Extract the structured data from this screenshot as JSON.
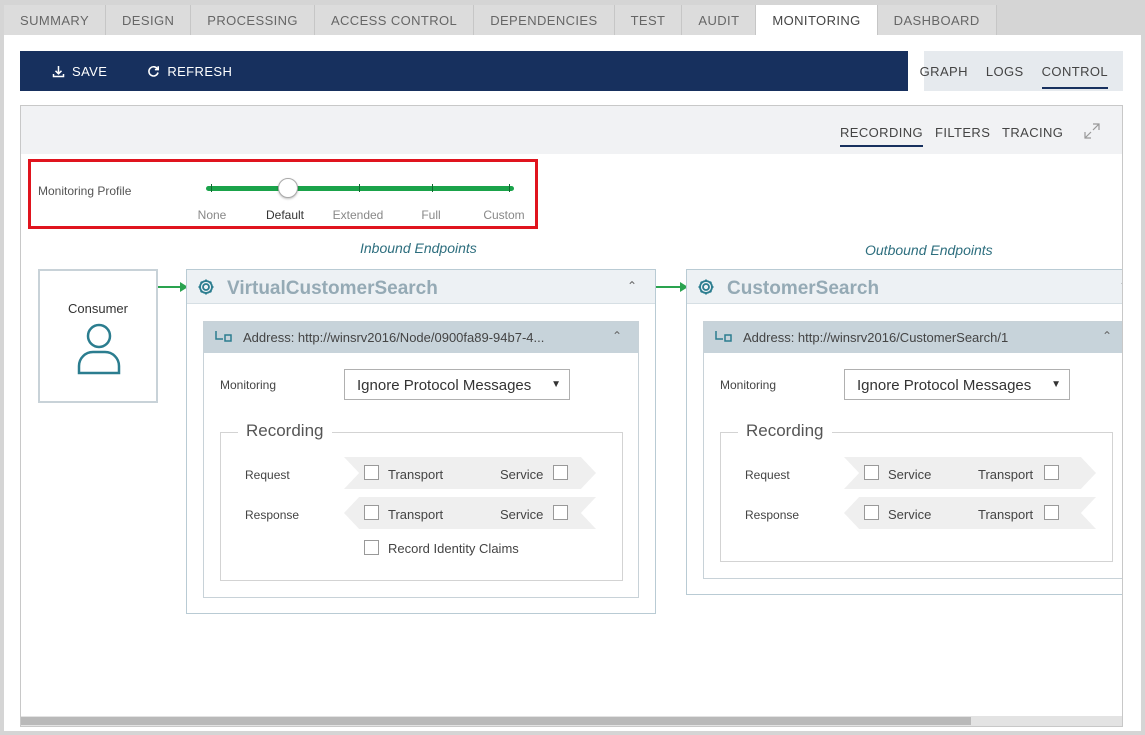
{
  "tabs": [
    {
      "label": "SUMMARY",
      "active": false
    },
    {
      "label": "DESIGN",
      "active": false
    },
    {
      "label": "PROCESSING",
      "active": false
    },
    {
      "label": "ACCESS CONTROL",
      "active": false
    },
    {
      "label": "DEPENDENCIES",
      "active": false
    },
    {
      "label": "TEST",
      "active": false
    },
    {
      "label": "AUDIT",
      "active": false
    },
    {
      "label": "MONITORING",
      "active": true
    },
    {
      "label": "DASHBOARD",
      "active": false
    }
  ],
  "toolbar": {
    "save_label": "SAVE",
    "save_icon": "download-icon",
    "refresh_label": "REFRESH",
    "refresh_icon": "refresh-icon",
    "color": "#17305e"
  },
  "view_tabs": [
    {
      "label": "GRAPH",
      "active": false
    },
    {
      "label": "LOGS",
      "active": false
    },
    {
      "label": "CONTROL",
      "active": true
    }
  ],
  "panel_tabs": [
    {
      "label": "RECORDING",
      "active": true
    },
    {
      "label": "FILTERS",
      "active": false
    },
    {
      "label": "TRACING",
      "active": false
    }
  ],
  "monitoring_profile": {
    "label": "Monitoring Profile",
    "levels": [
      "None",
      "Default",
      "Extended",
      "Full",
      "Custom"
    ],
    "selected": "Default",
    "track_color": "#1aa34a",
    "highlight_color": "#e0141e"
  },
  "sections": {
    "inbound_title": "Inbound Endpoints",
    "outbound_title": "Outbound Endpoints"
  },
  "consumer": {
    "label": "Consumer",
    "icon": "user-icon"
  },
  "services": [
    {
      "name": "VirtualCustomerSearch",
      "address": "Address: http://winsrv2016/Node/0900fa89-94b7-4...",
      "monitoring_label": "Monitoring",
      "monitoring_value": "Ignore Protocol Messages",
      "recording_title": "Recording",
      "request_label": "Request",
      "request_left": "Transport",
      "request_right": "Service",
      "response_label": "Response",
      "response_left": "Transport",
      "response_right": "Service",
      "identity_claims_label": "Record Identity Claims"
    },
    {
      "name": "CustomerSearch",
      "address": "Address: http://winsrv2016/CustomerSearch/1",
      "monitoring_label": "Monitoring",
      "monitoring_value": "Ignore Protocol Messages",
      "recording_title": "Recording",
      "request_label": "Request",
      "request_left": "Service",
      "request_right": "Transport",
      "response_label": "Response",
      "response_left": "Service",
      "response_right": "Transport"
    }
  ]
}
